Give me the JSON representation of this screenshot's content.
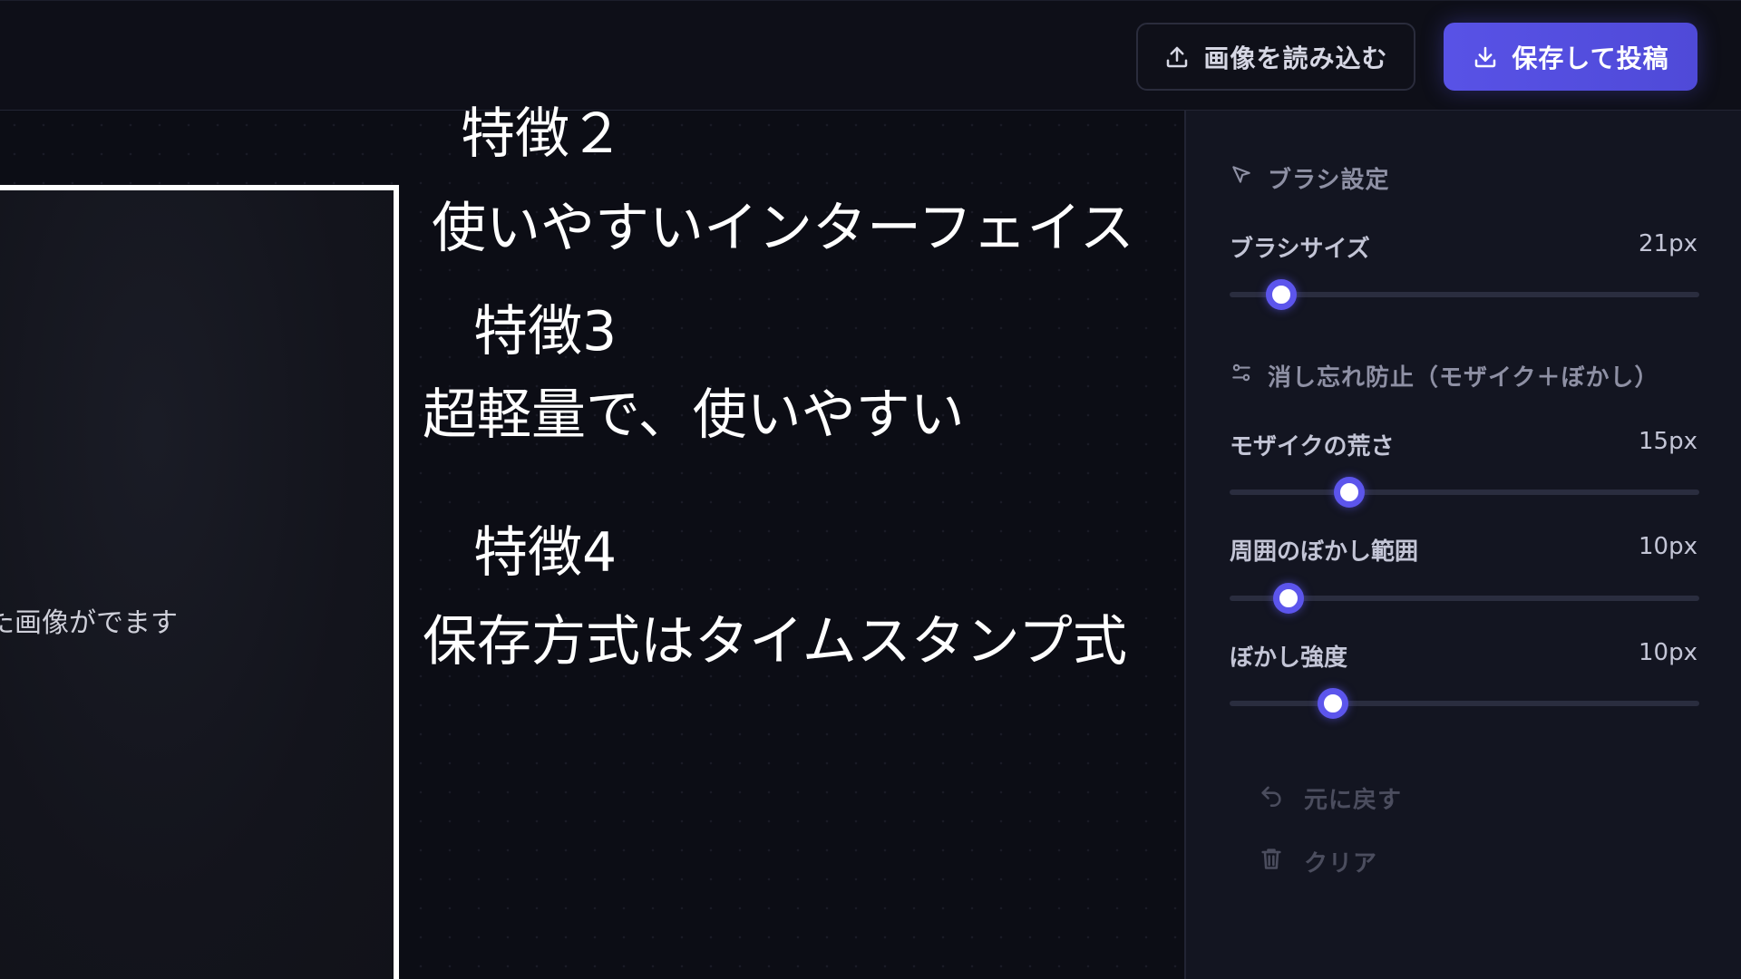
{
  "toolbar": {
    "load_label": "画像を読み込む",
    "save_label": "保存して投稿",
    "upload_icon": "upload-icon",
    "download_icon": "download-icon"
  },
  "canvas": {
    "frame_caption": "た画像がでます"
  },
  "overlay": {
    "feature2_title": "特徴２",
    "feature2_text": "使いやすいインターフェイス",
    "feature3_title": "特徴3",
    "feature3_text": "超軽量で、使いやすい",
    "feature4_title": "特徴4",
    "feature4_text": "保存方式はタイムスタンプ式"
  },
  "panel": {
    "brush_section": "ブラシ設定",
    "brush_size": {
      "label": "ブラシサイズ",
      "value": "21px",
      "fraction": 0.11
    },
    "prevent_section": "消し忘れ防止（モザイク＋ぼかし）",
    "mosaic": {
      "label": "モザイクの荒さ",
      "value": "15px",
      "fraction": 0.255
    },
    "blur_range": {
      "label": "周囲のぼかし範囲",
      "value": "10px",
      "fraction": 0.125
    },
    "blur_strength": {
      "label": "ぼかし強度",
      "value": "10px",
      "fraction": 0.22
    },
    "undo_label": "元に戻す",
    "clear_label": "クリア"
  },
  "colors": {
    "accent": "#5852e6",
    "background": "#0d0e16",
    "panel": "#131521"
  }
}
